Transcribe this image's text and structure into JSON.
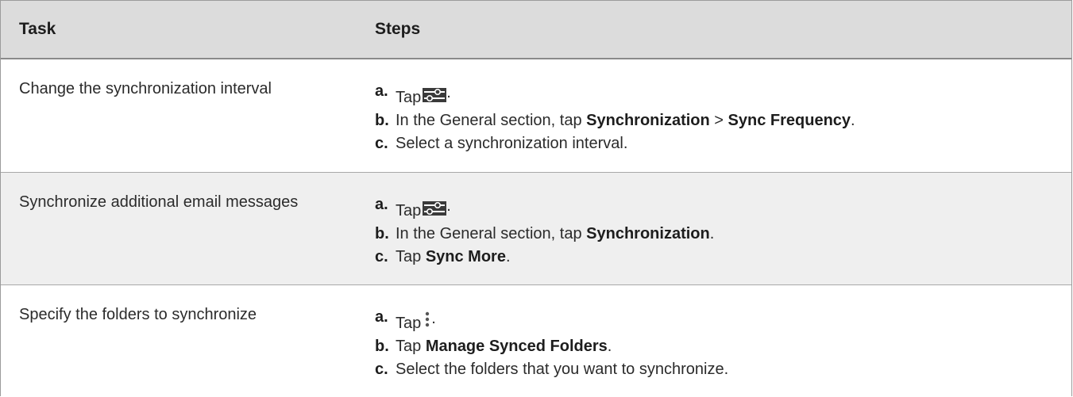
{
  "header": {
    "task": "Task",
    "steps": "Steps"
  },
  "rows": [
    {
      "task": "Change the synchronization interval",
      "steps": [
        {
          "label": "a.",
          "pre": "Tap",
          "icon": "settings-sliders-icon",
          "post": "."
        },
        {
          "label": "b.",
          "pre": "In the General section, tap ",
          "bold1": "Synchronization",
          "mid": " > ",
          "bold2": "Sync Frequency",
          "post": "."
        },
        {
          "label": "c.",
          "text": "Select a synchronization interval."
        }
      ]
    },
    {
      "task": "Synchronize additional email messages",
      "steps": [
        {
          "label": "a.",
          "pre": "Tap",
          "icon": "settings-sliders-icon",
          "post": "."
        },
        {
          "label": "b.",
          "pre": "In the General section, tap ",
          "bold1": "Synchronization",
          "post": "."
        },
        {
          "label": "c.",
          "pre": "Tap ",
          "bold1": "Sync More",
          "post": "."
        }
      ]
    },
    {
      "task": "Specify the folders to synchronize",
      "steps": [
        {
          "label": "a.",
          "pre": "Tap",
          "icon": "more-vertical-icon",
          "post": "."
        },
        {
          "label": "b.",
          "pre": "Tap ",
          "bold1": "Manage Synced Folders",
          "post": "."
        },
        {
          "label": "c.",
          "text": "Select the folders that you want to synchronize."
        }
      ]
    }
  ]
}
